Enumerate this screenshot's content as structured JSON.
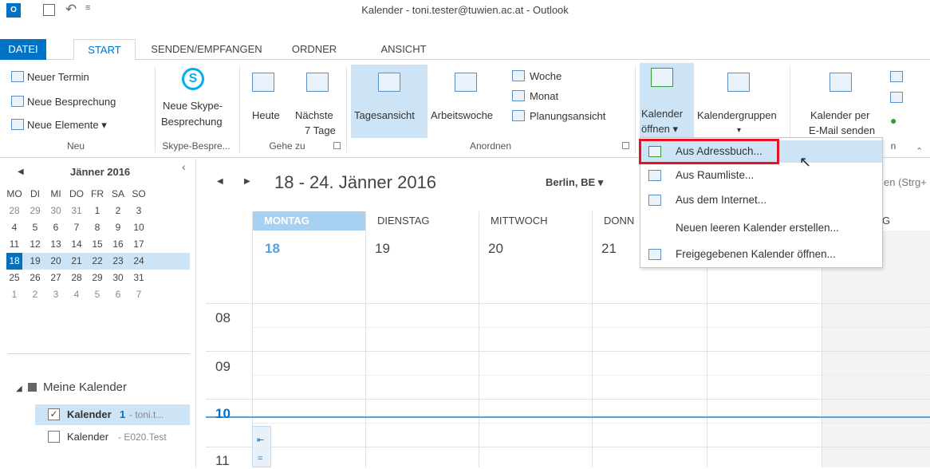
{
  "window": {
    "title": "Kalender - toni.tester@tuwien.ac.at - Outlook"
  },
  "tabs": [
    "DATEI",
    "START",
    "SENDEN/EMPFANGEN",
    "ORDNER",
    "ANSICHT"
  ],
  "ribbon": {
    "neu": {
      "items": [
        "Neuer Termin",
        "Neue Besprechung",
        "Neue Elemente ▾"
      ],
      "label": "Neu"
    },
    "skype": {
      "button_l1": "Neue Skype-",
      "button_l2": "Besprechung",
      "label": "Skype-Bespre..."
    },
    "gehezu": {
      "heute": "Heute",
      "naechste_l1": "Nächste",
      "naechste_l2": "7 Tage",
      "label": "Gehe zu"
    },
    "anordnen": {
      "tagesansicht": "Tagesansicht",
      "arbeitswoche": "Arbeitswoche",
      "woche": "Woche",
      "monat": "Monat",
      "planungsansicht": "Planungsansicht",
      "label": "Anordnen"
    },
    "kalender_oeffnen_l1": "Kalender",
    "kalender_oeffnen_l2": "öffnen ▾",
    "kalendergruppen": "Kalendergruppen",
    "kalender_email_l1": "Kalender per",
    "kalender_email_l2": "E-Mail senden",
    "group_tail": "n"
  },
  "minical": {
    "month": "Jänner 2016",
    "weekdays": [
      "MO",
      "DI",
      "MI",
      "DO",
      "FR",
      "SA",
      "SO"
    ],
    "weeks": [
      [
        "28",
        "29",
        "30",
        "31",
        "1",
        "2",
        "3"
      ],
      [
        "4",
        "5",
        "6",
        "7",
        "8",
        "9",
        "10"
      ],
      [
        "11",
        "12",
        "13",
        "14",
        "15",
        "16",
        "17"
      ],
      [
        "18",
        "19",
        "20",
        "21",
        "22",
        "23",
        "24"
      ],
      [
        "25",
        "26",
        "27",
        "28",
        "29",
        "30",
        "31"
      ],
      [
        "1",
        "2",
        "3",
        "4",
        "5",
        "6",
        "7"
      ]
    ],
    "selected_week": 3,
    "today": "18"
  },
  "calendars": {
    "group": "Meine Kalender",
    "item1_name": "Kalender",
    "item1_count": "1",
    "item1_owner": "- toni.t...",
    "item2_name": "Kalender",
    "item2_owner": "- E020.Test"
  },
  "calendar": {
    "range": "18 - 24. Jänner 2016",
    "location": "Berlin, BE ▾",
    "search": "en (Strg+",
    "days": [
      "MONTAG",
      "DIENSTAG",
      "MITTWOCH",
      "DONN",
      "G"
    ],
    "dates": [
      "18",
      "19",
      "20",
      "21"
    ],
    "hours": [
      "08",
      "09",
      "10",
      "11"
    ]
  },
  "menu": {
    "items": [
      "Aus Adressbuch...",
      "Aus Raumliste...",
      "Aus dem Internet...",
      "Neuen leeren Kalender erstellen...",
      "Freigegebenen Kalender öffnen..."
    ]
  },
  "colors": {
    "accent": "#0072c6",
    "highlight": "#cde4f7",
    "red_frame": "#e81123"
  }
}
